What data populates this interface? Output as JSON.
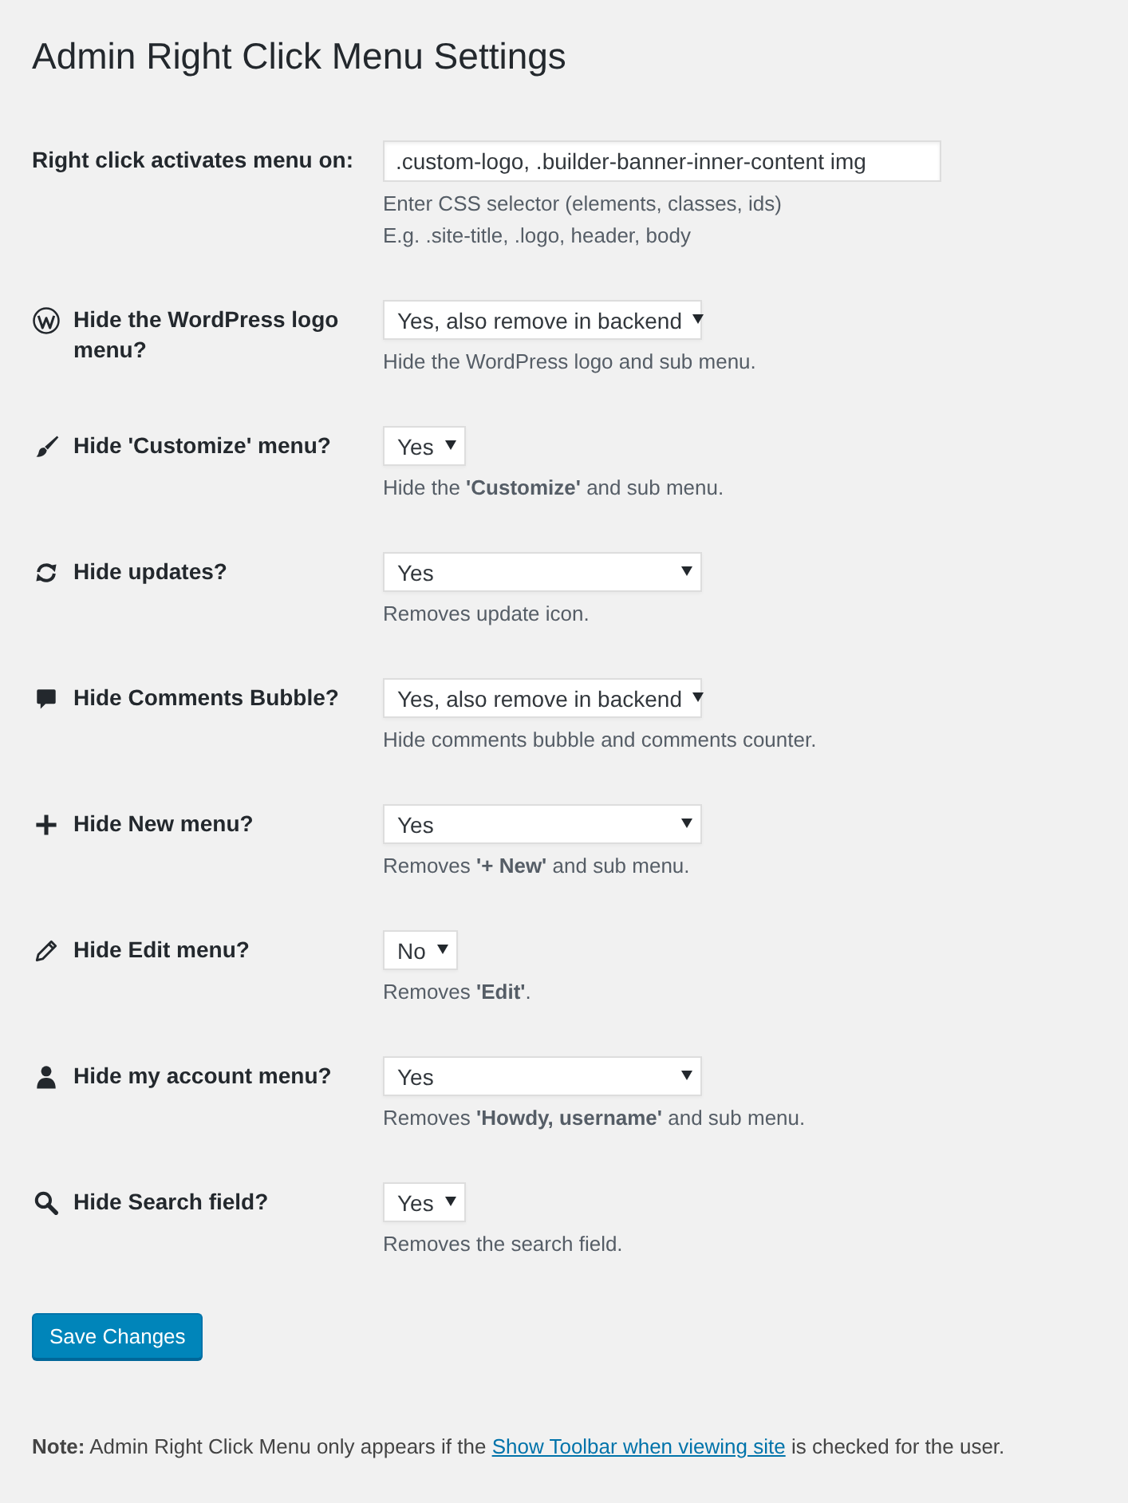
{
  "page_title": "Admin Right Click Menu Settings",
  "selector_setting": {
    "label": "Right click activates menu on:",
    "value": ".custom-logo, .builder-banner-inner-content img",
    "descriptions": [
      "Enter CSS selector (elements, classes, ids)",
      "E.g. .site-title, .logo, header, body"
    ]
  },
  "options": [
    {
      "label": "Hide the WordPress logo menu?",
      "value": "Yes, also remove in backend",
      "kind": "wide-select",
      "description": "Hide the WordPress logo and sub menu."
    },
    {
      "label": "Hide 'Customize' menu?",
      "value": "Yes",
      "kind": "compact-select",
      "description": "Hide the **'Customize'** and sub menu."
    },
    {
      "label": "Hide updates?",
      "value": "Yes",
      "kind": "wide-select",
      "description": "Removes update icon."
    },
    {
      "label": "Hide Comments Bubble?",
      "value": "Yes, also remove in backend",
      "kind": "wide-select",
      "description": "Hide comments bubble and comments counter."
    },
    {
      "label": "Hide New menu?",
      "value": "Yes",
      "kind": "wide-select",
      "description": "Removes **'+ New'** and sub menu."
    },
    {
      "label": "Hide Edit menu?",
      "value": "No",
      "kind": "compact-select",
      "description": "Removes **'Edit'**."
    },
    {
      "label": "Hide my account menu?",
      "value": "Yes",
      "kind": "wide-select",
      "description": "Removes **'Howdy, username'** and sub menu."
    },
    {
      "label": "Hide Search field?",
      "value": "Yes",
      "kind": "compact-select",
      "description": "Removes the search field."
    }
  ],
  "save_button": "Save Changes",
  "note": {
    "text": "**Note:** Admin Right Click Menu only appears if the",
    "link": "Show Toolbar when viewing site",
    "text_after": "is checked for the user."
  }
}
